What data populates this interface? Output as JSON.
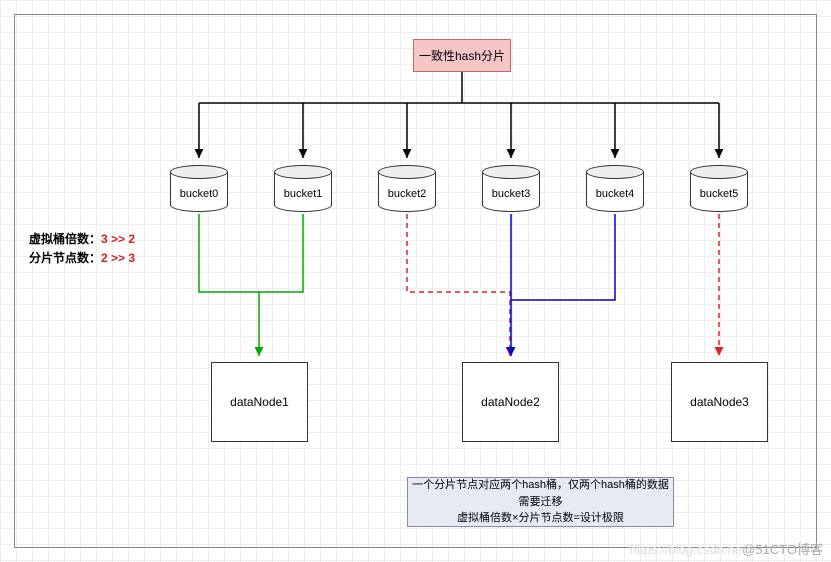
{
  "title": "一致性hash分片",
  "buckets": [
    "bucket0",
    "bucket1",
    "bucket2",
    "bucket3",
    "bucket4",
    "bucket5"
  ],
  "side": {
    "line1_label": "虚拟桶倍数：",
    "line1_from": "3",
    "line1_arrow": ">>",
    "line1_to": "2",
    "line2_label": "分片节点数：",
    "line2_from": "2",
    "line2_arrow": ">>",
    "line2_to": "3"
  },
  "dataNodes": [
    "dataNode1",
    "dataNode2",
    "dataNode3"
  ],
  "note": "一个分片节点对应两个hash桶，仅两个hash桶的数据需要迁移\n虚拟桶倍数×分片节点数=设计极限",
  "watermark_faint": "https://blog.csdn.ne",
  "watermark": "@51CTO博客",
  "chart_data": {
    "type": "diagram",
    "root": "一致性hash分片",
    "root_children": [
      "bucket0",
      "bucket1",
      "bucket2",
      "bucket3",
      "bucket4",
      "bucket5"
    ],
    "edges": [
      {
        "from": "bucket0",
        "to": "dataNode1",
        "style": "solid",
        "color": "green"
      },
      {
        "from": "bucket1",
        "to": "dataNode1",
        "style": "solid",
        "color": "green"
      },
      {
        "from": "bucket2",
        "to": "dataNode2",
        "style": "dashed",
        "color": "red"
      },
      {
        "from": "bucket3",
        "to": "dataNode2",
        "style": "solid",
        "color": "blue"
      },
      {
        "from": "bucket4",
        "to": "dataNode2",
        "style": "solid",
        "color": "blue"
      },
      {
        "from": "bucket5",
        "to": "dataNode3",
        "style": "dashed",
        "color": "red"
      }
    ],
    "parameter_changes": {
      "虚拟桶倍数": {
        "from": 3,
        "to": 2
      },
      "分片节点数": {
        "from": 2,
        "to": 3
      }
    }
  }
}
